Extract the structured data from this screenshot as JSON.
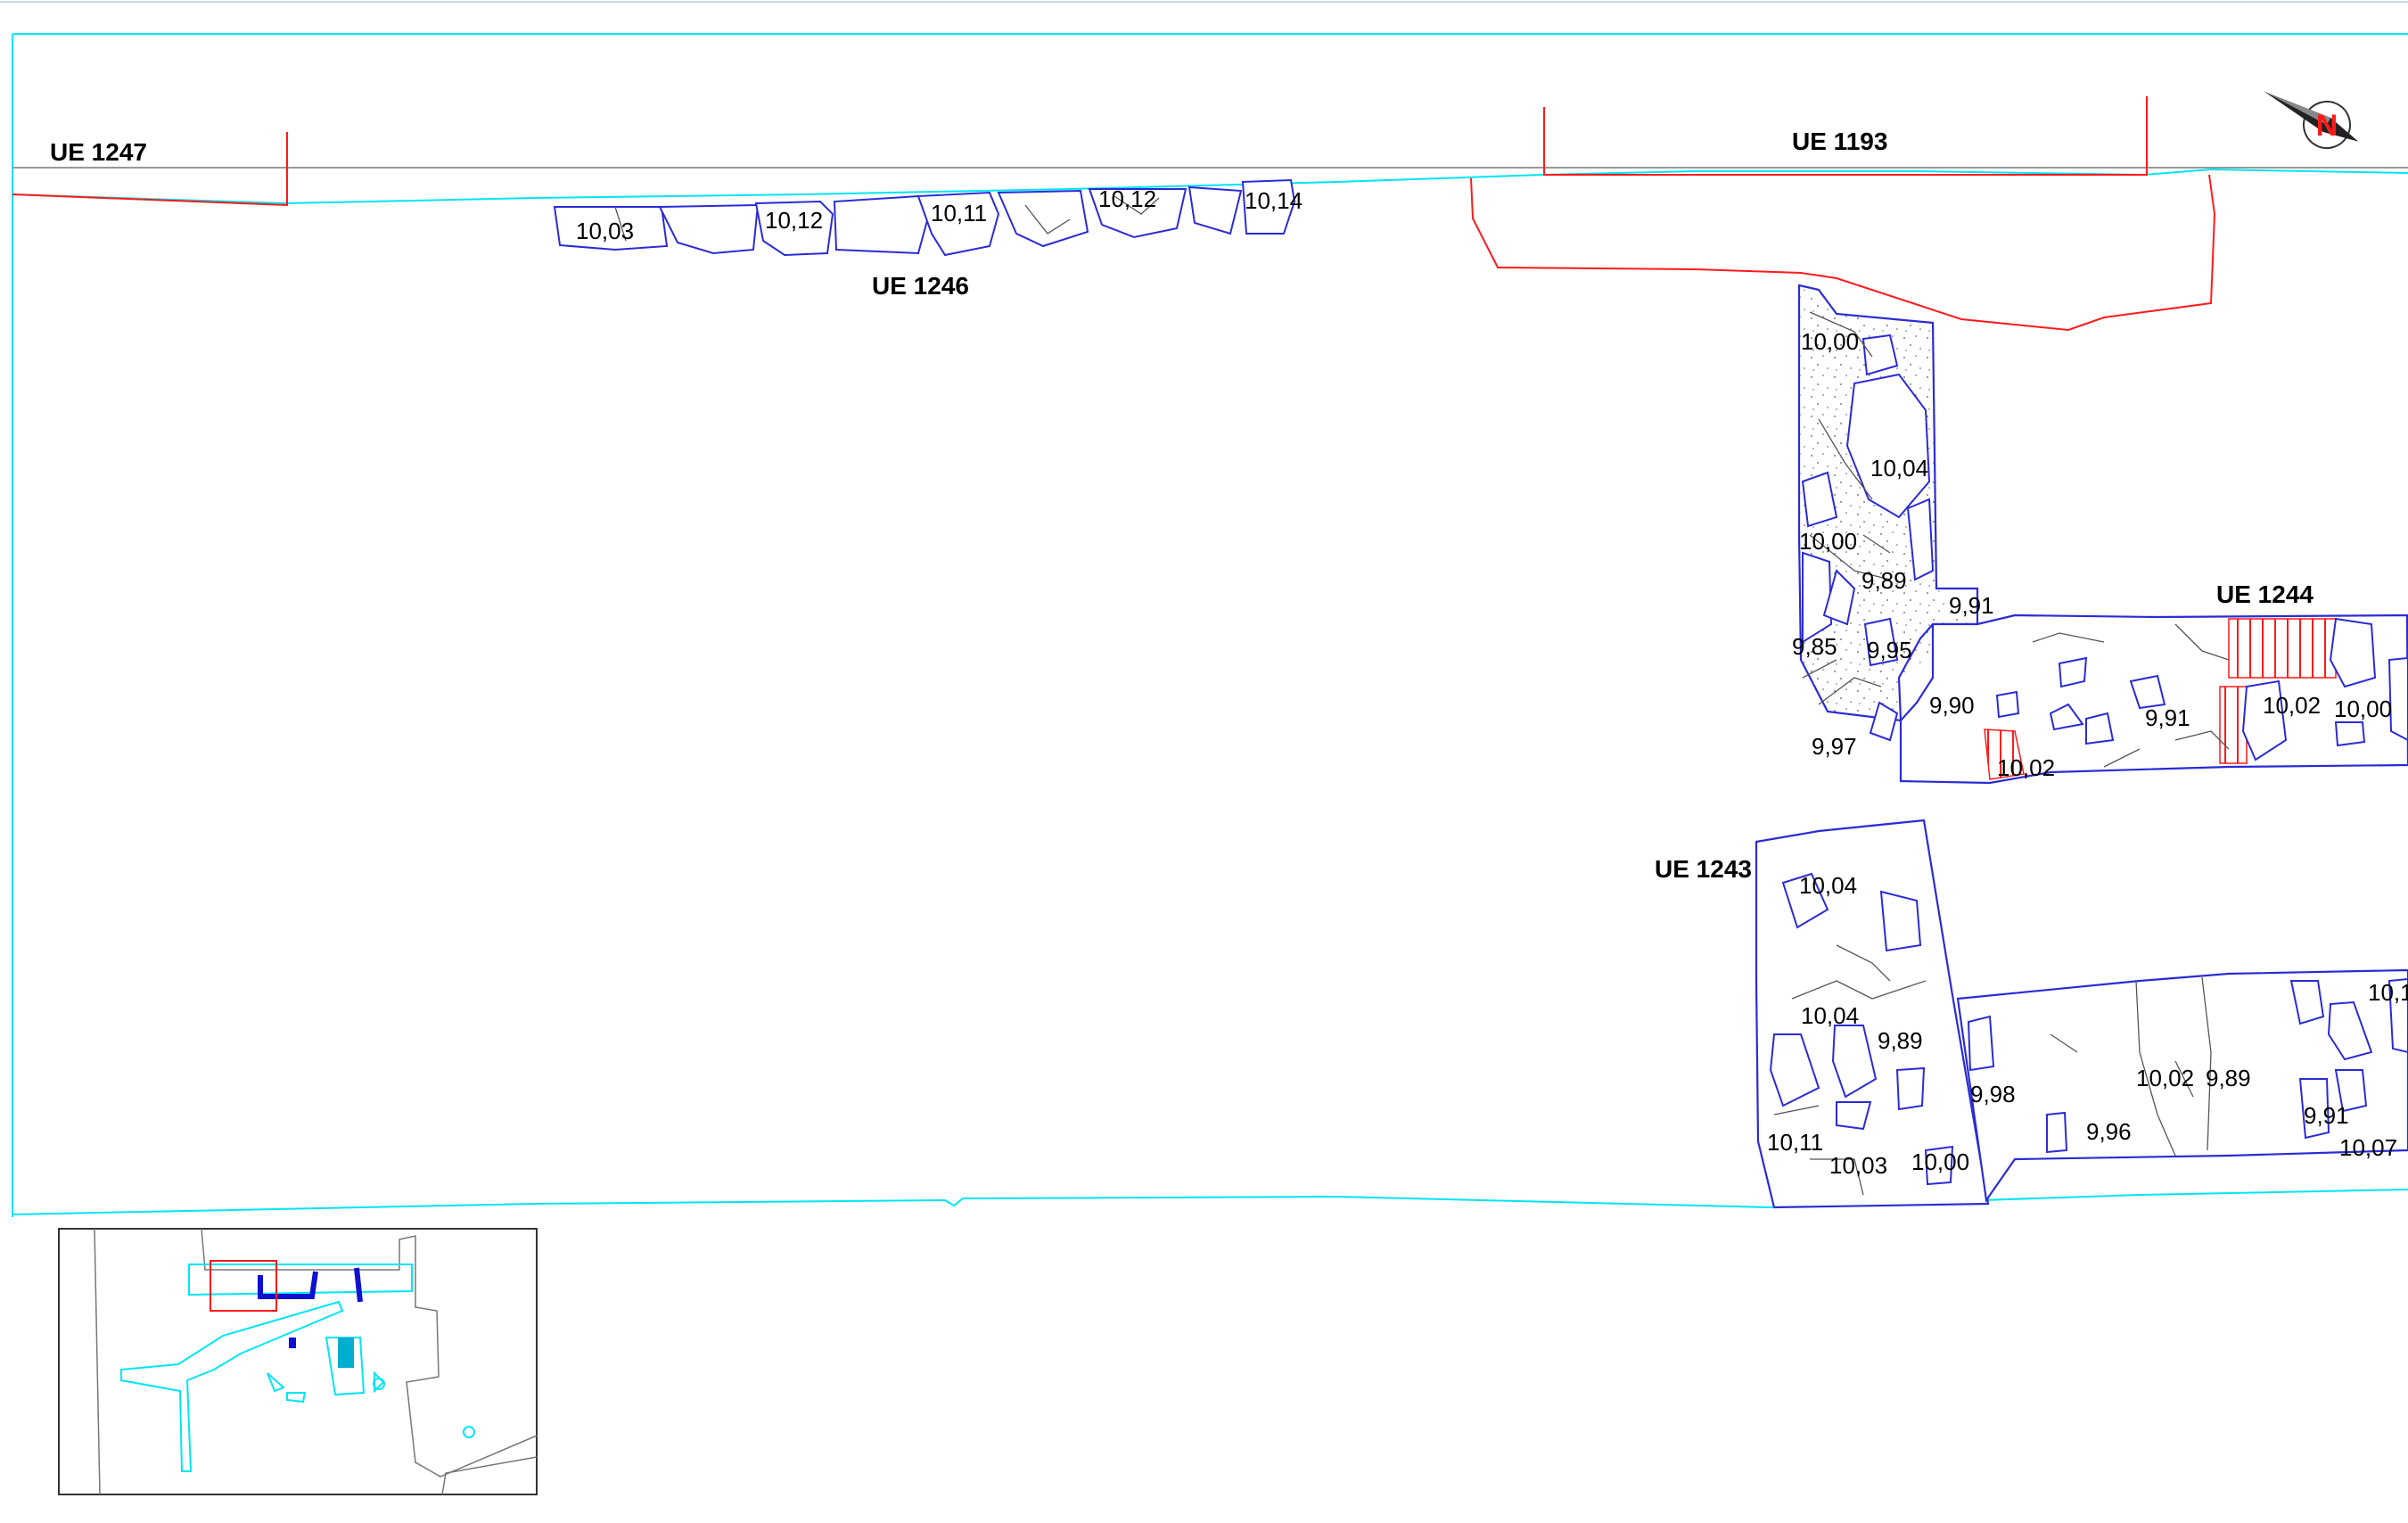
{
  "drawing": {
    "frame_color": "#00e5f5",
    "masonry_color": "#2b2bd6",
    "cut_color": "#ff1a1a",
    "stone_outline_color": "#555555"
  },
  "units": {
    "ue_1247": "UE 1247",
    "ue_1246": "UE 1246",
    "ue_1193": "UE 1193",
    "ue_1244": "UE 1244",
    "ue_1243": "UE 1243"
  },
  "elevations": {
    "top_row": [
      "10,03",
      "10,12",
      "10,11",
      "10,12",
      "10,14"
    ],
    "wall_1193": [
      "10,00",
      "10,04",
      "10,00",
      "9,89",
      "9,91",
      "9,85",
      "9,95",
      "9,90",
      "9,97"
    ],
    "wall_1244": [
      "10,02",
      "9,91",
      "10,02",
      "10,00"
    ],
    "wall_1243": [
      "10,04",
      "10,04",
      "9,89",
      "9,98",
      "10,02",
      "9,89",
      "9,91",
      "10,07",
      "10,11",
      "10,03",
      "10,00",
      "9,96",
      "10,1"
    ]
  },
  "north_arrow": {
    "icon": "north-arrow-icon",
    "letter": "N"
  },
  "location_map": {
    "icon": "site-key-plan"
  }
}
